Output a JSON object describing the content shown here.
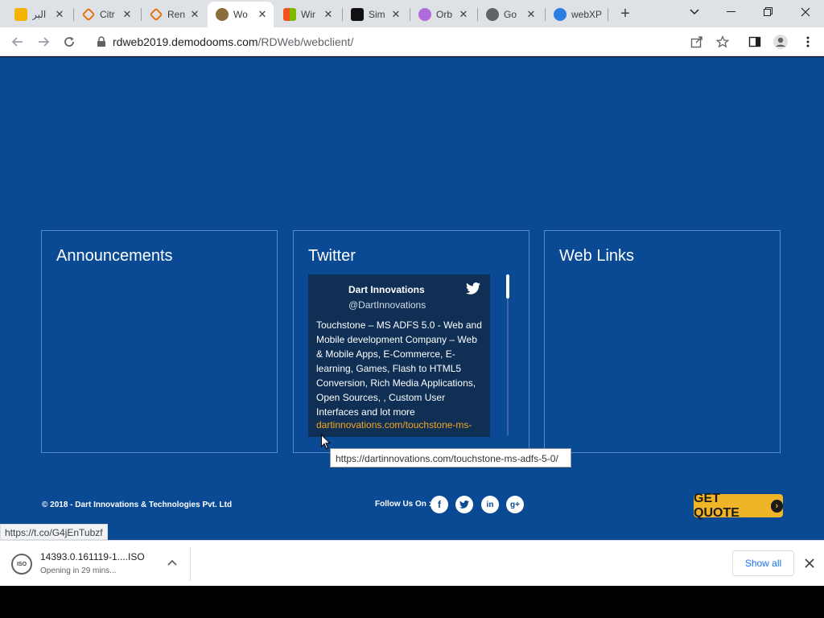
{
  "tabs": [
    {
      "title": "البر",
      "favicon_color": "#f4b400",
      "favicon_glyph": ""
    },
    {
      "title": "Citr",
      "favicon_color": "#e8710a",
      "favicon_glyph": ""
    },
    {
      "title": "Ren",
      "favicon_color": "#e8710a",
      "favicon_glyph": ""
    },
    {
      "title": "Wo",
      "favicon_color": "#8a6d3b",
      "favicon_glyph": "",
      "active": true
    },
    {
      "title": "Wir",
      "favicon_color": "#00a4ef",
      "favicon_glyph": ""
    },
    {
      "title": "Sim",
      "favicon_color": "#111111",
      "favicon_glyph": ""
    },
    {
      "title": "Orb",
      "favicon_color": "#b06ad9",
      "favicon_glyph": ""
    },
    {
      "title": "Go",
      "favicon_color": "#5f6368",
      "favicon_glyph": ""
    },
    {
      "title": "webXP",
      "favicon_color": "#2a7de1",
      "favicon_glyph": ""
    }
  ],
  "address": {
    "host": "rdweb2019.demodooms.com",
    "path": "/RDWeb/webclient/"
  },
  "panels": {
    "announcements": "Announcements",
    "twitter": "Twitter",
    "weblinks": "Web Links"
  },
  "tweet": {
    "author": "Dart Innovations",
    "handle": "@DartInnovations",
    "body": "Touchstone – MS ADFS 5.0 - Web and Mobile development Company – Web & Mobile Apps, E-Commerce, E-learning, Games, Flash to HTML5 Conversion, Rich Media Applications, Open Sources, , Custom User Interfaces and lot more",
    "link": "dartinnovations.com/touchstone-ms-"
  },
  "tooltip": "https://dartinnovations.com/touchstone-ms-adfs-5-0/",
  "footer": {
    "copyright": "© 2018 - Dart Innovations & Technologies Pvt. Ltd",
    "follow": "Follow Us On :",
    "get_quote": "GET QUOTE"
  },
  "status_url": "https://t.co/G4jEnTubzf",
  "download": {
    "filename": "14393.0.161119-1....ISO",
    "status": "Opening in 29 mins...",
    "file_badge": "ISO",
    "show_all": "Show all"
  },
  "colors": {
    "page_bg": "#0a4a94",
    "link": "#f5a623",
    "quote": "#f0b429"
  }
}
